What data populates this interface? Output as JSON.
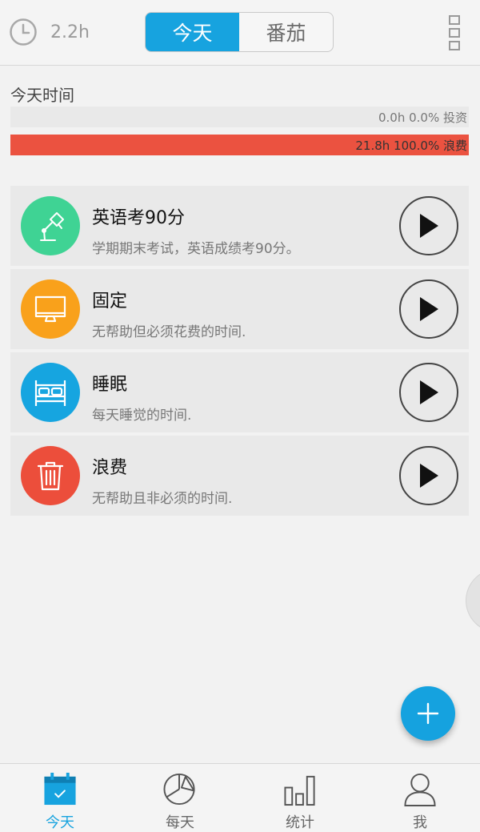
{
  "header": {
    "hours": "2.2h",
    "tabs": [
      {
        "label": "今天",
        "active": true
      },
      {
        "label": "番茄",
        "active": false
      }
    ]
  },
  "today": {
    "title": "今天时间",
    "invest": {
      "label": "0.0h 0.0% 投资",
      "fraction": 0.0
    },
    "waste": {
      "label": "21.8h 100.0% 浪费",
      "fraction": 1.0
    }
  },
  "activities": [
    {
      "title": "英语考90分",
      "desc": "学期期末考试，英语成绩考90分。",
      "icon": "desk-lamp-icon",
      "color": "#3fd394"
    },
    {
      "title": "固定",
      "desc": "无帮助但必须花费的时间.",
      "icon": "monitor-icon",
      "color": "#f9a11b"
    },
    {
      "title": "睡眠",
      "desc": "每天睡觉的时间.",
      "icon": "bed-icon",
      "color": "#16a5e0"
    },
    {
      "title": "浪费",
      "desc": "无帮助且非必须的时间.",
      "icon": "trash-icon",
      "color": "#ec4e3b"
    }
  ],
  "nav": [
    {
      "label": "今天",
      "icon": "calendar-icon",
      "active": true
    },
    {
      "label": "每天",
      "icon": "pie-chart-icon",
      "active": false
    },
    {
      "label": "统计",
      "icon": "bar-chart-icon",
      "active": false
    },
    {
      "label": "我",
      "icon": "user-icon",
      "active": false
    }
  ],
  "colors": {
    "accent": "#17a3df",
    "waste_bar": "#eb5240",
    "invest_bar": "#3fd394"
  }
}
